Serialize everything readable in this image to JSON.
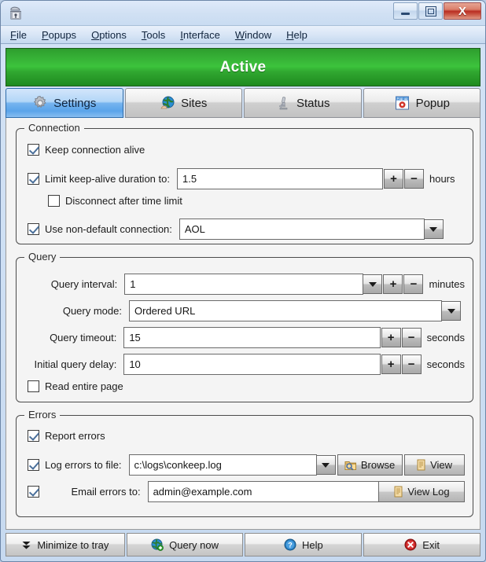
{
  "window": {
    "app_icon": "observatory-icon",
    "minimize_label": "Minimize",
    "maximize_label": "Maximize",
    "close_label": "X"
  },
  "menubar": {
    "items": [
      {
        "label": "File",
        "accesskey": "F"
      },
      {
        "label": "Popups",
        "accesskey": "P"
      },
      {
        "label": "Options",
        "accesskey": "O"
      },
      {
        "label": "Tools",
        "accesskey": "T"
      },
      {
        "label": "Interface",
        "accesskey": "I"
      },
      {
        "label": "Window",
        "accesskey": "W"
      },
      {
        "label": "Help",
        "accesskey": "H"
      }
    ]
  },
  "status_banner": {
    "text": "Active",
    "color": "#37b337",
    "text_color": "#ffffff"
  },
  "tabs": [
    {
      "label": "Settings",
      "icon": "gear-icon",
      "active": true
    },
    {
      "label": "Sites",
      "icon": "globe-hand-icon",
      "active": false
    },
    {
      "label": "Status",
      "icon": "microscope-icon",
      "active": false
    },
    {
      "label": "Popup",
      "icon": "popup-window-icon",
      "active": false
    }
  ],
  "connection": {
    "title": "Connection",
    "keep_alive": {
      "label": "Keep connection alive",
      "checked": true
    },
    "limit_duration": {
      "label": "Limit keep-alive duration to:",
      "checked": true,
      "value": "1.5",
      "unit": "hours",
      "plus": "+",
      "minus": "−"
    },
    "disconnect": {
      "label": "Disconnect after time limit",
      "checked": false
    },
    "non_default": {
      "label": "Use non-default connection:",
      "checked": true,
      "value": "AOL"
    }
  },
  "query": {
    "title": "Query",
    "interval": {
      "label": "Query interval:",
      "value": "1",
      "unit": "minutes",
      "plus": "+",
      "minus": "−"
    },
    "mode": {
      "label": "Query mode:",
      "value": "Ordered URL"
    },
    "timeout": {
      "label": "Query timeout:",
      "value": "15",
      "unit": "seconds",
      "plus": "+",
      "minus": "−"
    },
    "initial_delay": {
      "label": "Initial query delay:",
      "value": "10",
      "unit": "seconds",
      "plus": "+",
      "minus": "−"
    },
    "read_entire_page": {
      "label": "Read entire page",
      "checked": false
    }
  },
  "errors": {
    "title": "Errors",
    "report": {
      "label": "Report errors",
      "checked": true
    },
    "log_to_file": {
      "label": "Log errors to file:",
      "checked": true,
      "value": "c:\\logs\\conkeep.log",
      "browse_label": "Browse",
      "view_label": "View"
    },
    "email_to": {
      "label": "Email errors to:",
      "checked": true,
      "value": "admin@example.com",
      "view_log_label": "View Log"
    }
  },
  "bottombar": [
    {
      "label": "Minimize to tray",
      "icon": "double-chevron-down-icon"
    },
    {
      "label": "Query now",
      "icon": "globe-plus-icon"
    },
    {
      "label": "Help",
      "icon": "help-circle-icon"
    },
    {
      "label": "Exit",
      "icon": "exit-circle-icon"
    }
  ]
}
